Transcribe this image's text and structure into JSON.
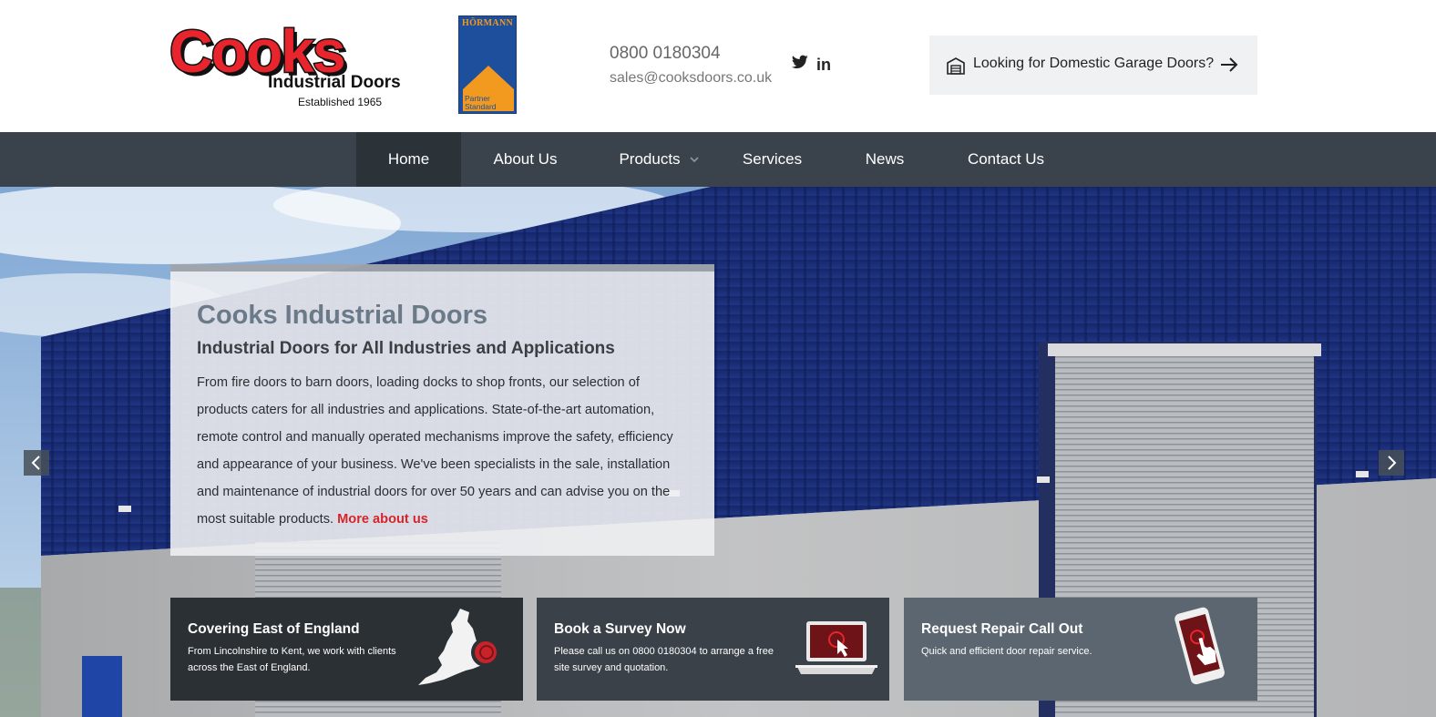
{
  "header": {
    "logo": {
      "word": "Cooks",
      "subtitle": "Industrial Doors",
      "established": "Established 1965"
    },
    "partner_badge": {
      "brand": "HÖRMANN",
      "line1": "Partner",
      "line2": "Standard"
    },
    "contact": {
      "phone": "0800 0180304",
      "email": "sales@cooksdoors.co.uk"
    },
    "social": {
      "linkedin": "in"
    },
    "domestic_cta": "Looking for Domestic Garage Doors?"
  },
  "nav": {
    "items": [
      {
        "label": "Home"
      },
      {
        "label": "About Us"
      },
      {
        "label": "Products"
      },
      {
        "label": "Services"
      },
      {
        "label": "News"
      },
      {
        "label": "Contact Us"
      }
    ]
  },
  "hero": {
    "title": "Cooks Industrial Doors",
    "subtitle": "Industrial Doors for All Industries and Applications",
    "body": "From fire doors to barn doors, loading docks to shop fronts, our selection of products caters for all industries and applications. State-of-the-art automation, remote control and manually operated mechanisms improve the safety, efficiency and appearance of your business. We've been specialists in the sale, installation and maintenance of industrial doors for over 50 years and can advise you on the most suitable products.",
    "link": "More about us"
  },
  "tiles": [
    {
      "title": "Covering East of England",
      "text": "From Lincolnshire to Kent, we work with clients across the East of England."
    },
    {
      "title": "Book a Survey Now",
      "text": "Please call us on 0800 0180304 to arrange a free site survey and quotation."
    },
    {
      "title": "Request Repair Call Out",
      "text": "Quick and efficient door repair service."
    }
  ],
  "colors": {
    "nav_bg": "#3a434b",
    "nav_active": "#2b3238",
    "brand_red": "#e8252d",
    "link_red": "#d6252a",
    "hormann_blue": "#1d4f9c",
    "hormann_orange": "#f29a1f"
  }
}
